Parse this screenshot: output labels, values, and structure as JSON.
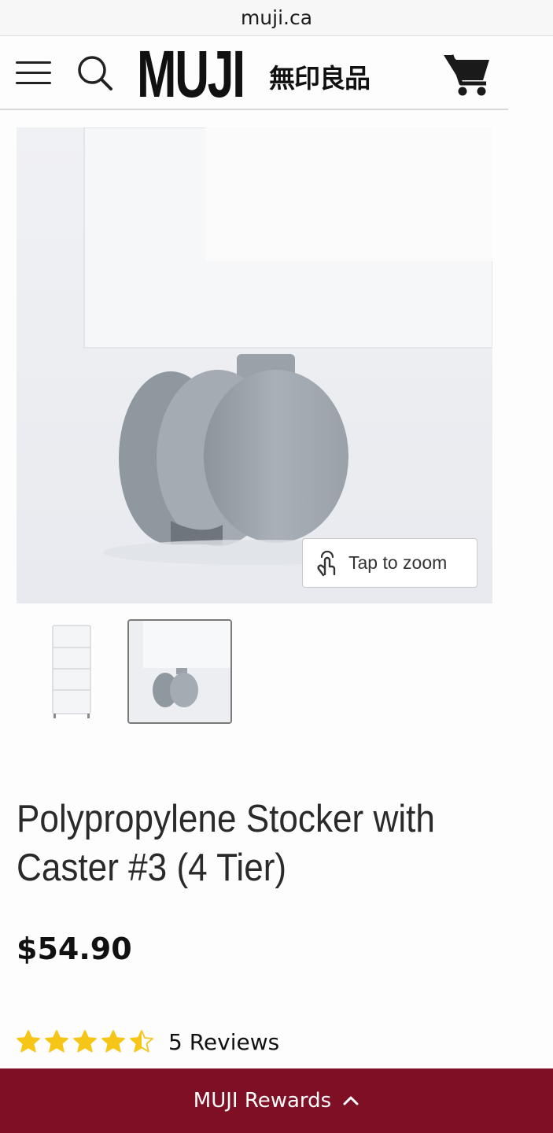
{
  "browser": {
    "url": "muji.ca"
  },
  "header": {
    "logo_text": "MUJI",
    "logo_jp": "無印良品",
    "icons": {
      "menu": "hamburger-menu-icon",
      "search": "search-icon",
      "cart": "shopping-cart-icon"
    }
  },
  "hero": {
    "zoom_label": "Tap to zoom",
    "zoom_icon": "tap-gesture-icon",
    "selected_image_index": 2
  },
  "product": {
    "title": "Polypropylene Stocker with Caster #3 (4 Tier)",
    "price": "$54.90",
    "rating": 4.5,
    "rating_max": 5,
    "reviews_label": "5 Reviews"
  },
  "rewards_bar": {
    "label": "MUJI Rewards",
    "icon": "chevron-up-icon"
  },
  "colors": {
    "rewards_bg": "#7f0f24",
    "star": "#f5c518",
    "text": "#222222"
  }
}
